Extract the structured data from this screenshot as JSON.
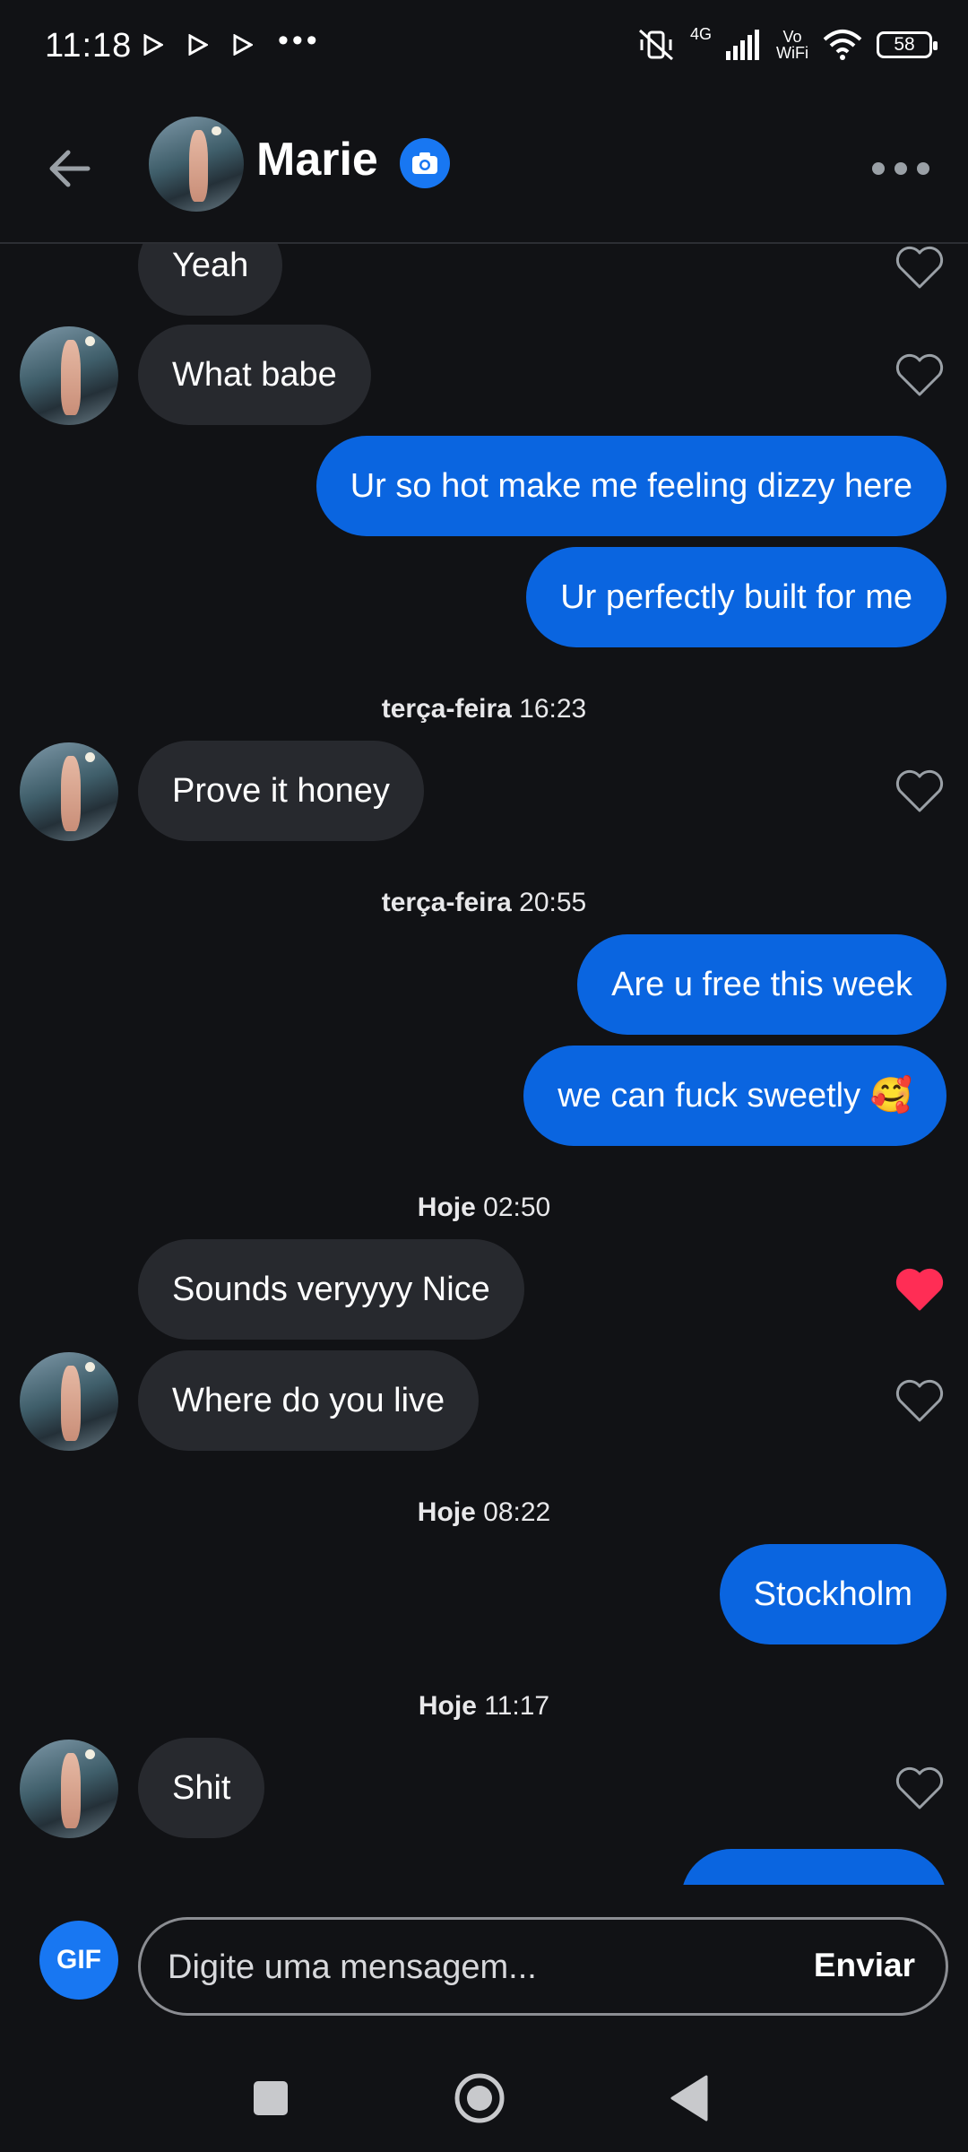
{
  "status_bar": {
    "time": "11:18",
    "network": "4G",
    "volte": "Vo\nWiFi",
    "battery": "58"
  },
  "header": {
    "contact_name": "Marie"
  },
  "messages": [
    {
      "text": "Yeah"
    },
    {
      "text": "What babe"
    },
    {
      "text": "Ur so hot make me feeling dizzy here"
    },
    {
      "text": "Ur perfectly built for me"
    },
    {
      "day": "terça-feira",
      "time": "16:23"
    },
    {
      "text": "Prove it honey"
    },
    {
      "day": "terça-feira",
      "time": "20:55"
    },
    {
      "text": "Are u free this week"
    },
    {
      "text": "we can fuck sweetly 🥰"
    },
    {
      "day": "Hoje",
      "time": "02:50"
    },
    {
      "text": "Sounds veryyyy Nice",
      "liked": true
    },
    {
      "text": "Where do you live"
    },
    {
      "day": "Hoje",
      "time": "08:22"
    },
    {
      "text": "Stockholm"
    },
    {
      "day": "Hoje",
      "time": "11:17"
    },
    {
      "text": "Shit"
    }
  ],
  "composer": {
    "gif_label": "GIF",
    "placeholder": "Digite uma mensagem...",
    "send_label": "Enviar"
  },
  "colors": {
    "background": "#111215",
    "incoming_bubble": "#27292e",
    "outgoing_bubble": "#0a65e0",
    "accent": "#1877f2",
    "liked_heart": "#ff2d55"
  },
  "icons": [
    "back-arrow-icon",
    "camera-icon",
    "more-icon",
    "heart-outline-icon",
    "heart-filled-icon",
    "stop-square-icon",
    "home-circle-icon",
    "back-triangle-icon"
  ]
}
